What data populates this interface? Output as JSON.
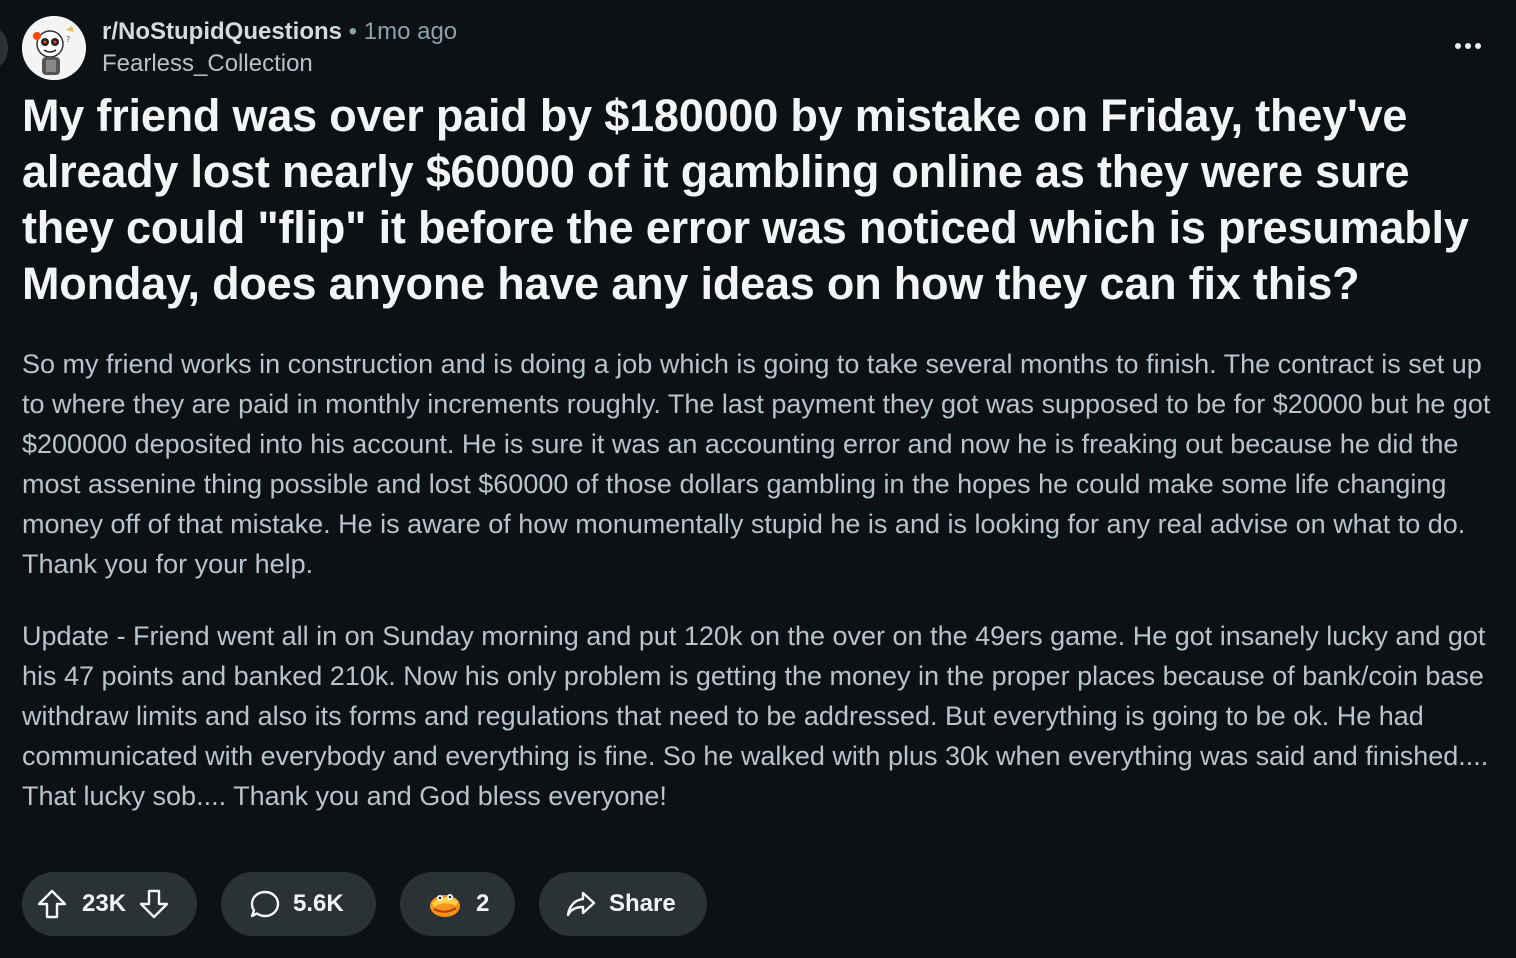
{
  "post": {
    "subreddit": "r/NoStupidQuestions",
    "separator": "•",
    "time_ago": "1mo ago",
    "author": "Fearless_Collection",
    "title": "My friend was over paid by $180000 by mistake on Friday, they've already lost nearly $60000 of it gambling online as they were sure they could \"flip\" it before the error was noticed which is presumably Monday, does anyone have any ideas on how they can fix this?",
    "body": [
      "So my friend works in construction and is doing a job which is going to take several months to finish. The contract is set up to where they are paid in monthly increments roughly. The last payment they got was supposed to be for $20000 but he got $200000 deposited into his account. He is sure it was an accounting error and now he is freaking out because he did the most assenine thing possible and lost $60000 of those dollars gambling in the hopes he could make some life changing money off of that mistake. He is aware of how monumentally stupid he is and is looking for any real advise on what to do. Thank you for your help.",
      "Update - Friend went all in on Sunday morning and put 120k on the over on the 49ers game. He got insanely lucky and got his 47 points and banked 210k. Now his only problem is getting the money in the proper places because of bank/coin base withdraw limits and also its forms and regulations that need to be addressed. But everything is going to be ok. He had communicated with everybody and everything is fine. So he walked with plus 30k when everything was said and finished.... That lucky sob.... Thank you and God bless everyone!"
    ]
  },
  "actions": {
    "votes": "23K",
    "comments": "5.6K",
    "awards": "2",
    "share_label": "Share"
  },
  "icons": {
    "upvote": "arrow-up-icon",
    "downvote": "arrow-down-icon",
    "comment": "comment-bubble-icon",
    "award": "award-icon",
    "share": "share-arrow-icon",
    "more": "more-options-icon"
  },
  "colors": {
    "background": "#0e1113",
    "pill": "#2a3236",
    "title": "#f2f4f5",
    "body_text": "#b7c4cc",
    "muted": "#8ba2ad",
    "award_orange": "#f7921e"
  }
}
